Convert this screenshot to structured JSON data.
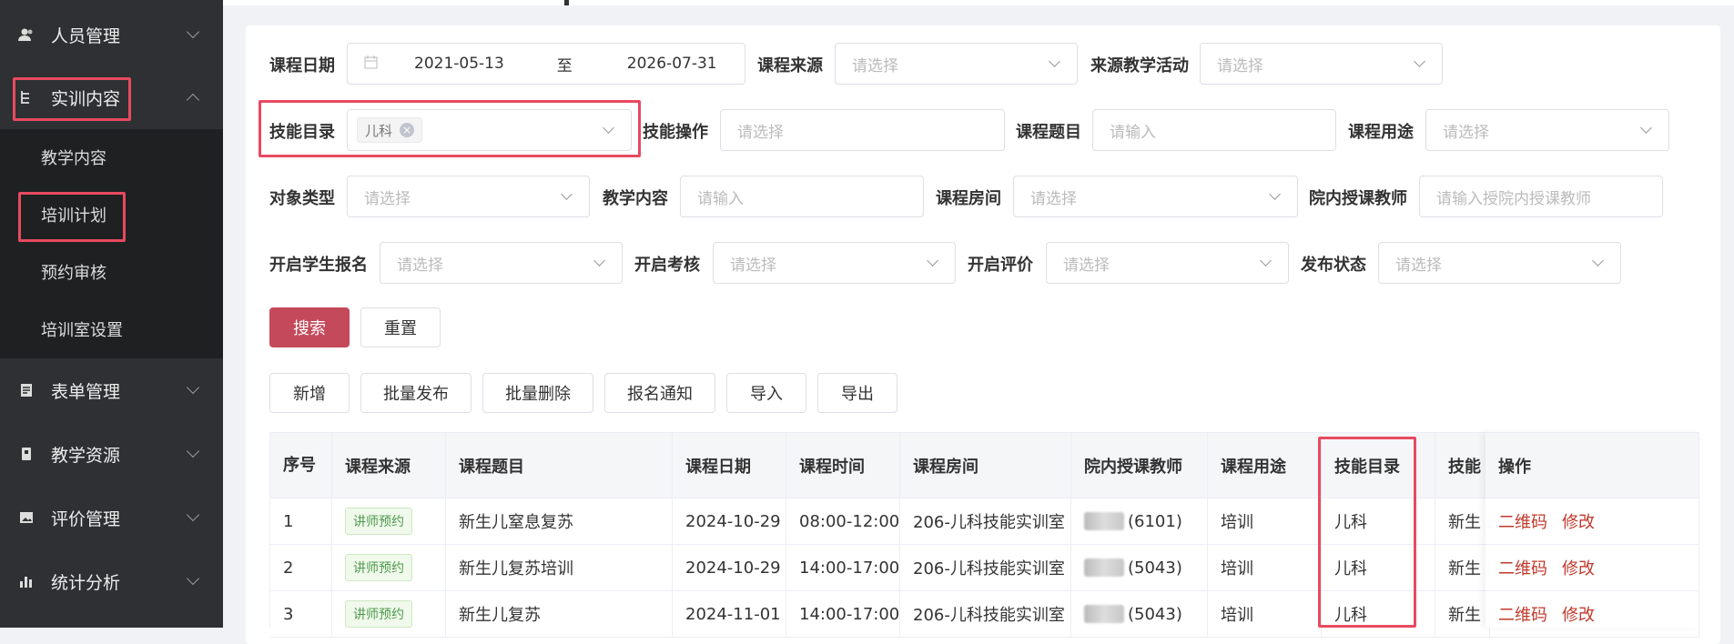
{
  "sidebar": {
    "menu": [
      {
        "label": "人员管理",
        "icon": "users-icon"
      },
      {
        "label": "实训内容",
        "icon": "file-tree-icon"
      },
      {
        "label": "表单管理",
        "icon": "form-icon"
      },
      {
        "label": "教学资源",
        "icon": "book-icon"
      },
      {
        "label": "评价管理",
        "icon": "image-icon"
      },
      {
        "label": "统计分析",
        "icon": "bar-chart-icon"
      }
    ],
    "submenu": [
      "教学内容",
      "培训计划",
      "预约审核",
      "培训室设置"
    ]
  },
  "filters": {
    "course_date": {
      "label": "课程日期",
      "start": "2021-05-13",
      "sep": "至",
      "end": "2026-07-31"
    },
    "course_source": {
      "label": "课程来源",
      "placeholder": "请选择"
    },
    "source_activity": {
      "label": "来源教学活动",
      "placeholder": "请选择"
    },
    "skill_catalog": {
      "label": "技能目录",
      "tag": "儿科"
    },
    "skill_operation": {
      "label": "技能操作",
      "placeholder": "请选择"
    },
    "course_topic": {
      "label": "课程题目",
      "placeholder": "请输入"
    },
    "course_use": {
      "label": "课程用途",
      "placeholder": "请选择"
    },
    "object_type": {
      "label": "对象类型",
      "placeholder": "请选择"
    },
    "teaching_content": {
      "label": "教学内容",
      "placeholder": "请输入"
    },
    "course_room": {
      "label": "课程房间",
      "placeholder": "请选择"
    },
    "internal_teacher": {
      "label": "院内授课教师",
      "placeholder": "请输入授院内授课教师"
    },
    "student_signup": {
      "label": "开启学生报名",
      "placeholder": "请选择"
    },
    "exam": {
      "label": "开启考核",
      "placeholder": "请选择"
    },
    "evaluation": {
      "label": "开启评价",
      "placeholder": "请选择"
    },
    "publish_status": {
      "label": "发布状态",
      "placeholder": "请选择"
    }
  },
  "search_buttons": {
    "search": "搜索",
    "reset": "重置"
  },
  "actions": [
    "新增",
    "批量发布",
    "批量删除",
    "报名通知",
    "导入",
    "导出"
  ],
  "table": {
    "headers": {
      "index": "序号",
      "source": "课程来源",
      "topic": "课程题目",
      "date": "课程日期",
      "time": "课程时间",
      "room": "课程房间",
      "teacher": "院内授课教师",
      "use": "课程用途",
      "skill": "技能目录",
      "skill_op": "技能",
      "ops": "操作"
    },
    "rows": [
      {
        "index": "1",
        "source": "讲师预约",
        "topic": "新生儿窒息复苏",
        "date": "2024-10-29",
        "time": "08:00-12:00",
        "room": "206-儿科技能实训室",
        "teacher_id": "(6101)",
        "use": "培训",
        "skill": "儿科",
        "skill_op": "新生",
        "qr": "二维码",
        "edit": "修改"
      },
      {
        "index": "2",
        "source": "讲师预约",
        "topic": "新生儿复苏培训",
        "date": "2024-10-29",
        "time": "14:00-17:00",
        "room": "206-儿科技能实训室",
        "teacher_id": "(5043)",
        "use": "培训",
        "skill": "儿科",
        "skill_op": "新生",
        "qr": "二维码",
        "edit": "修改"
      },
      {
        "index": "3",
        "source": "讲师预约",
        "topic": "新生儿复苏",
        "date": "2024-11-01",
        "time": "14:00-17:00",
        "room": "206-儿科技能实训室",
        "teacher_id": "(5043)",
        "use": "培训",
        "skill": "儿科",
        "skill_op": "新生",
        "qr": "二维码",
        "edit": "修改"
      }
    ]
  }
}
